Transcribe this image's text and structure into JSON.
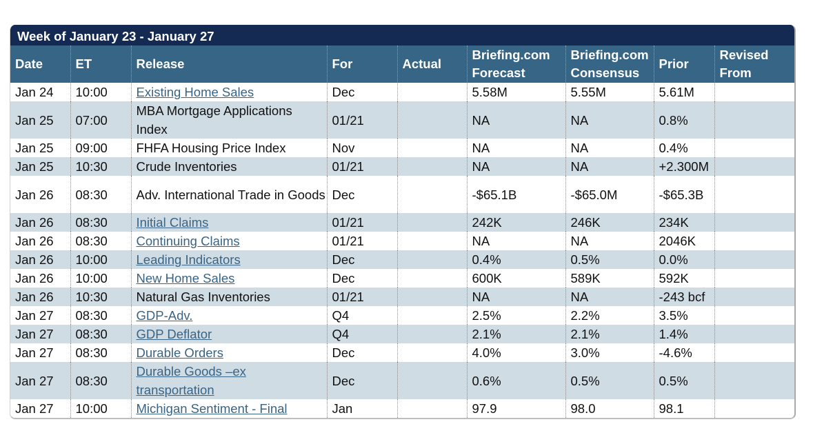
{
  "calendar": {
    "title": "Week of January 23 - January 27",
    "columns": {
      "date": "Date",
      "et": "ET",
      "release": "Release",
      "for": "For",
      "actual": "Actual",
      "forecast_line1": "Briefing.com",
      "forecast_line2": "Forecast",
      "consensus_line1": "Briefing.com",
      "consensus_line2": "Consensus",
      "prior": "Prior",
      "revised_line1": "Revised",
      "revised_line2": "From"
    },
    "rows": [
      {
        "date": "Jan 24",
        "et": "10:00",
        "release": "Existing Home Sales",
        "link": true,
        "for": "Dec",
        "actual": "",
        "forecast": "5.58M",
        "consensus": "5.55M",
        "prior": "5.61M",
        "revised": ""
      },
      {
        "date": "Jan 25",
        "et": "07:00",
        "release": "MBA Mortgage Applications Index",
        "link": false,
        "for": "01/21",
        "actual": "",
        "forecast": "NA",
        "consensus": "NA",
        "prior": "0.8%",
        "revised": ""
      },
      {
        "date": "Jan 25",
        "et": "09:00",
        "release": "FHFA Housing Price Index",
        "link": false,
        "for": "Nov",
        "actual": "",
        "forecast": "NA",
        "consensus": "NA",
        "prior": "0.4%",
        "revised": ""
      },
      {
        "date": "Jan 25",
        "et": "10:30",
        "release": "Crude Inventories",
        "link": false,
        "for": "01/21",
        "actual": "",
        "forecast": "NA",
        "consensus": "NA",
        "prior": "+2.300M",
        "revised": ""
      },
      {
        "date": "Jan 26",
        "et": "08:30",
        "release": "Adv. International Trade in Goods",
        "link": false,
        "for": "Dec",
        "actual": "",
        "forecast": "-$65.1B",
        "consensus": "-$65.0M",
        "prior": "-$65.3B",
        "revised": ""
      },
      {
        "date": "Jan 26",
        "et": "08:30",
        "release": "Initial Claims",
        "link": true,
        "for": "01/21",
        "actual": "",
        "forecast": "242K",
        "consensus": "246K",
        "prior": "234K",
        "revised": ""
      },
      {
        "date": "Jan 26",
        "et": "08:30",
        "release": "Continuing Claims",
        "link": true,
        "for": "01/21",
        "actual": "",
        "forecast": "NA",
        "consensus": "NA",
        "prior": "2046K",
        "revised": ""
      },
      {
        "date": "Jan 26",
        "et": "10:00",
        "release": "Leading Indicators",
        "link": true,
        "for": "Dec",
        "actual": "",
        "forecast": "0.4%",
        "consensus": "0.5%",
        "prior": "0.0%",
        "revised": ""
      },
      {
        "date": "Jan 26",
        "et": "10:00",
        "release": "New Home Sales",
        "link": true,
        "for": "Dec",
        "actual": "",
        "forecast": "600K",
        "consensus": "589K",
        "prior": "592K",
        "revised": ""
      },
      {
        "date": "Jan 26",
        "et": "10:30",
        "release": "Natural Gas Inventories",
        "link": false,
        "for": "01/21",
        "actual": "",
        "forecast": "NA",
        "consensus": "NA",
        "prior": "-243 bcf",
        "revised": ""
      },
      {
        "date": "Jan 27",
        "et": "08:30",
        "release": "GDP-Adv.",
        "link": true,
        "for": "Q4",
        "actual": "",
        "forecast": "2.5%",
        "consensus": "2.2%",
        "prior": "3.5%",
        "revised": ""
      },
      {
        "date": "Jan 27",
        "et": "08:30",
        "release": "GDP Deflator",
        "link": true,
        "for": "Q4",
        "actual": "",
        "forecast": "2.1%",
        "consensus": "2.1%",
        "prior": "1.4%",
        "revised": ""
      },
      {
        "date": "Jan 27",
        "et": "08:30",
        "release": "Durable Orders",
        "link": true,
        "for": "Dec",
        "actual": "",
        "forecast": "4.0%",
        "consensus": "3.0%",
        "prior": "-4.6%",
        "revised": ""
      },
      {
        "date": "Jan 27",
        "et": "08:30",
        "release": "Durable Goods –ex transportation",
        "link": true,
        "for": "Dec",
        "actual": "",
        "forecast": "0.6%",
        "consensus": "0.5%",
        "prior": "0.5%",
        "revised": ""
      },
      {
        "date": "Jan 27",
        "et": "10:00",
        "release": "Michigan Sentiment - Final",
        "link": true,
        "for": "Jan",
        "actual": "",
        "forecast": "97.9",
        "consensus": "98.0",
        "prior": "98.1",
        "revised": ""
      }
    ]
  }
}
